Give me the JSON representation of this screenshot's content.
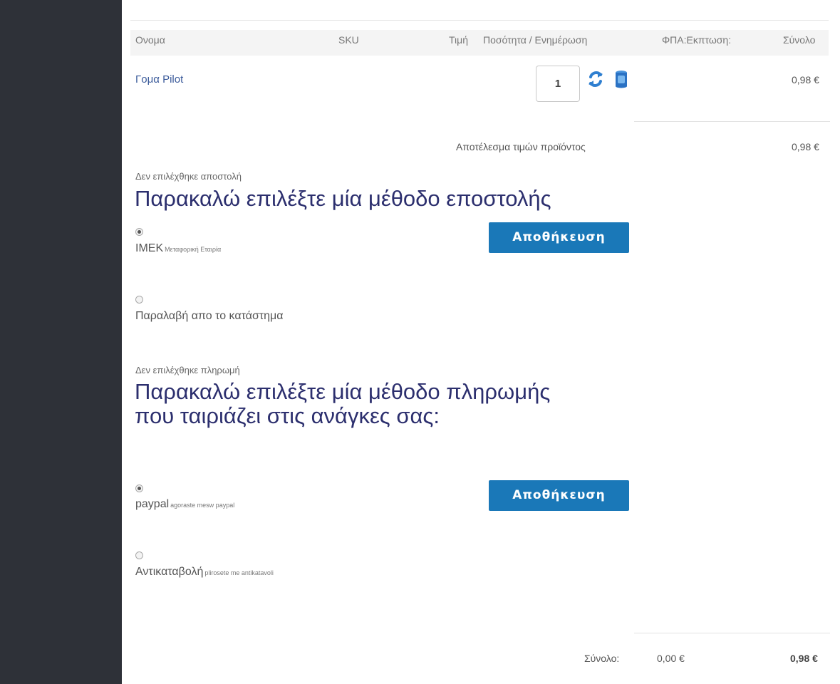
{
  "table": {
    "headers": {
      "name": "Ονομα",
      "sku": "SKU",
      "price": "Τιμή",
      "qty_update": "Ποσότητα / Ενημέρωση",
      "vat_discount": "ΦΠΑ:Εκπτωση:",
      "total": "Σύνολο"
    },
    "rows": [
      {
        "name": "Γομα Pilot",
        "quantity": "1",
        "total": "0,98 €"
      }
    ],
    "subtotal_label": "Αποτέλεσμα τιμών προϊόντος",
    "subtotal_value": "0,98 €"
  },
  "shipping": {
    "not_selected": "Δεν επιλέχθηκε αποστολή",
    "heading": "Παρακαλώ επιλέξτε μία μέθοδο εποστολής",
    "options": [
      {
        "label": "IMEK",
        "desc": "Μεταφορική Εταιρία",
        "checked": true
      },
      {
        "label": "Παραλαβή απο το κατάστημα",
        "desc": "",
        "checked": false
      }
    ],
    "save_label": "Αποθήκευση"
  },
  "payment": {
    "not_selected": "Δεν επιλέχθηκε πληρωμή",
    "heading_line1": "Παρακαλώ επιλέξτε μία μέθοδο πληρωμής",
    "heading_line2": "που ταιριάζει στις ανάγκες σας:",
    "options": [
      {
        "label": "paypal",
        "desc": "agoraste mesw paypal",
        "checked": true
      },
      {
        "label": "Αντικαταβολή",
        "desc": "plirosete me antikatavoli",
        "checked": false
      }
    ],
    "save_label": "Αποθήκευση"
  },
  "footer": {
    "total_label": "Σύνολο:",
    "discount_value": "0,00 €",
    "grand_total": "0,98 €"
  },
  "colors": {
    "sidebar": "#2e3138",
    "heading": "#2c2f6e",
    "button": "#1a78b8",
    "product_link": "#3a5a9a"
  },
  "icons": {
    "update": "refresh-icon",
    "delete": "trash-icon"
  }
}
